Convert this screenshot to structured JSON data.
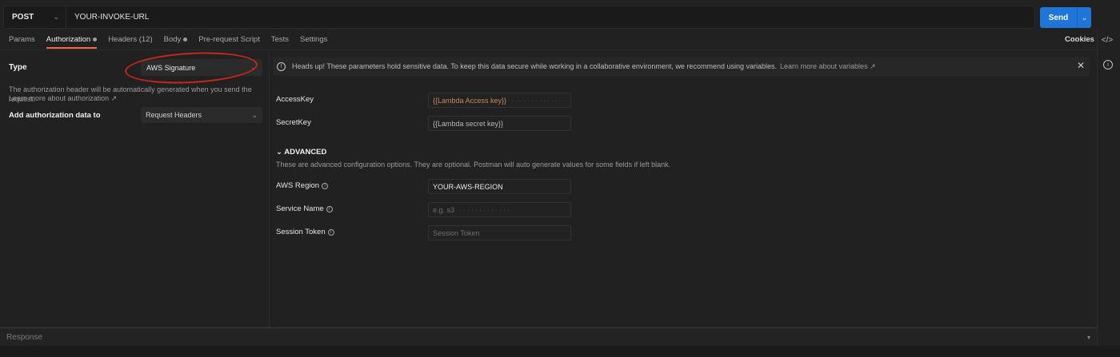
{
  "request": {
    "method": "POST",
    "url": "YOUR-INVOKE-URL",
    "send_label": "Send"
  },
  "tabs": [
    {
      "label": "Params",
      "active": false,
      "dot": false
    },
    {
      "label": "Authorization",
      "active": true,
      "dot": true
    },
    {
      "label": "Headers (12)",
      "active": false,
      "dot": false
    },
    {
      "label": "Body",
      "active": false,
      "dot": true
    },
    {
      "label": "Pre-request Script",
      "active": false,
      "dot": false
    },
    {
      "label": "Tests",
      "active": false,
      "dot": false
    },
    {
      "label": "Settings",
      "active": false,
      "dot": false
    }
  ],
  "cookies_label": "Cookies",
  "auth": {
    "type_label": "Type",
    "type_value": "AWS Signature",
    "description": "The authorization header will be automatically generated when you send the request.",
    "learn_more": "Learn more about authorization ↗",
    "add_to_label": "Add authorization data to",
    "add_to_value": "Request Headers"
  },
  "banner": {
    "text": "Heads up! These parameters hold sensitive data. To keep this data secure while working in a collaborative environment, we recommend using variables.",
    "link": "Learn more about variables ↗"
  },
  "fields": {
    "access_key": {
      "label": "AccessKey",
      "value": "{{Lambda Access key}}"
    },
    "secret_key": {
      "label": "SecretKey",
      "value": "{{Lambda secret key}}"
    }
  },
  "advanced": {
    "title": "ADVANCED",
    "description": "These are advanced configuration options. They are optional. Postman will auto generate values for some fields if left blank.",
    "region": {
      "label": "AWS Region",
      "value": "YOUR-AWS-REGION"
    },
    "service": {
      "label": "Service Name",
      "placeholder": "e.g. s3"
    },
    "session": {
      "label": "Session Token",
      "placeholder": "Session Token"
    }
  },
  "response_label": "Response",
  "colors": {
    "accent": "#f26b3a",
    "send": "#1f76d8",
    "annotation": "#c8261f",
    "variable": "#c9865f"
  },
  "icons": [
    "chevron-down-icon",
    "info-icon",
    "close-icon",
    "code-icon"
  ]
}
